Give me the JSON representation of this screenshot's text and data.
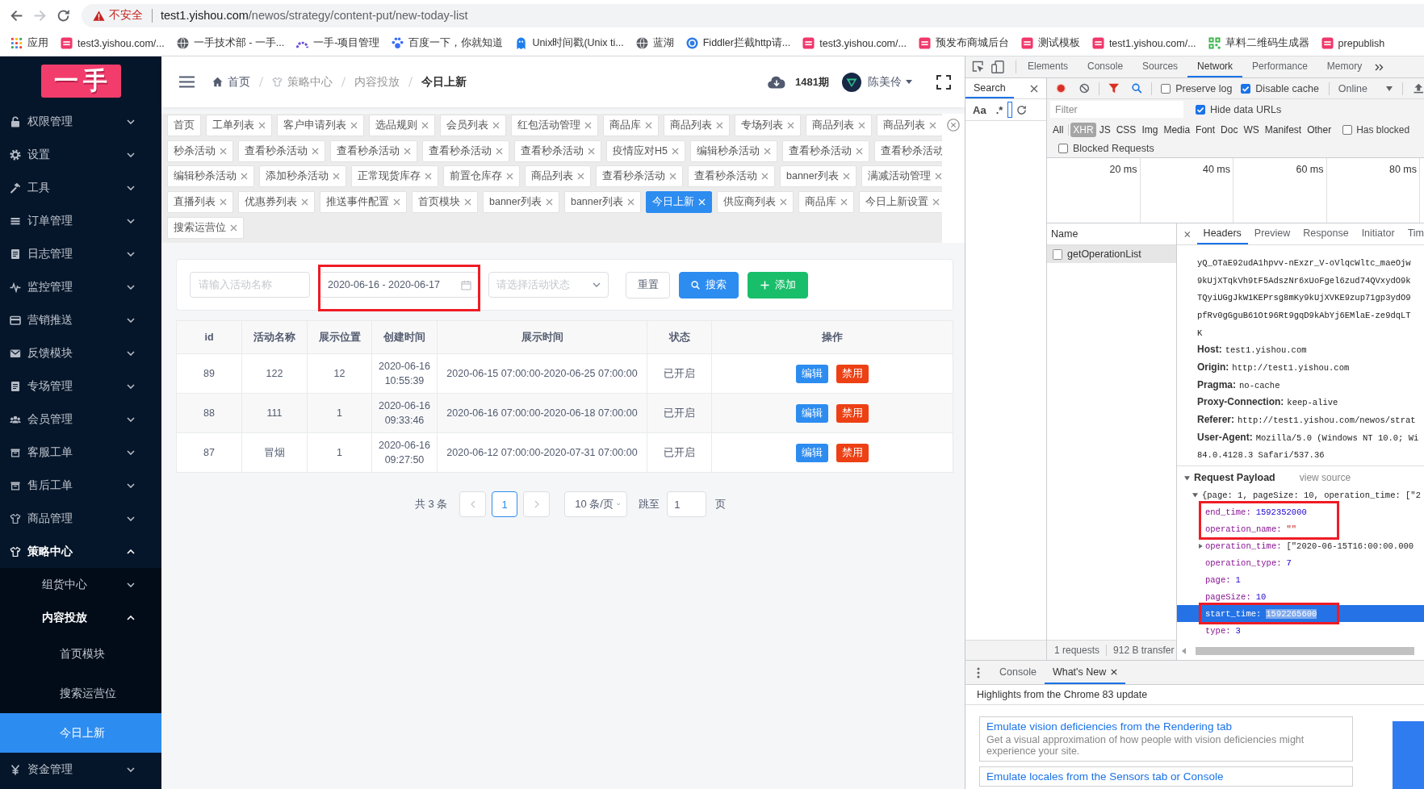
{
  "browser": {
    "back_disabled": false,
    "forward_disabled": true,
    "security": "不安全",
    "url_host": "test1.yishou.com",
    "url_path": "/newos/strategy/content-put/new-today-list",
    "bookmarks": [
      "应用",
      "test3.yishou.com/...",
      "一手技术部 - 一手...",
      "一手-项目管理",
      "百度一下，你就知道",
      "Unix时间戳(Unix ti...",
      "蓝湖",
      "Fiddler拦截http请...",
      "test3.yishou.com/...",
      "预发布商城后台",
      "测试模板",
      "test1.yishou.com/...",
      "草料二维码生成器",
      "prepublish"
    ]
  },
  "sidebar": {
    "logo": "一手",
    "items": [
      {
        "label": "权限管理",
        "expanded": false,
        "selected": false
      },
      {
        "label": "设置",
        "expanded": false,
        "selected": false
      },
      {
        "label": "工具",
        "expanded": false,
        "selected": false
      },
      {
        "label": "订单管理",
        "expanded": false,
        "selected": false
      },
      {
        "label": "日志管理",
        "expanded": false,
        "selected": false
      },
      {
        "label": "监控管理",
        "expanded": false,
        "selected": false
      },
      {
        "label": "营销推送",
        "expanded": false,
        "selected": false
      },
      {
        "label": "反馈模块",
        "expanded": false,
        "selected": false
      },
      {
        "label": "专场管理",
        "expanded": false,
        "selected": false
      },
      {
        "label": "会员管理",
        "expanded": false,
        "selected": false
      },
      {
        "label": "客服工单",
        "expanded": false,
        "selected": false
      },
      {
        "label": "售后工单",
        "expanded": false,
        "selected": false
      },
      {
        "label": "商品管理",
        "expanded": false,
        "selected": false
      },
      {
        "label": "策略中心",
        "expanded": true,
        "selected": false,
        "children": [
          {
            "label": "组货中心",
            "expanded": false,
            "selected": false
          },
          {
            "label": "内容投放",
            "expanded": true,
            "selected": false,
            "children": [
              {
                "label": "首页模块",
                "selected": false
              },
              {
                "label": "搜索运营位",
                "selected": false
              },
              {
                "label": "今日上新",
                "selected": true
              }
            ]
          }
        ]
      },
      {
        "label": "资金管理",
        "expanded": false,
        "selected": false
      }
    ]
  },
  "header": {
    "breadcrumb": [
      {
        "label": "首页",
        "link": true,
        "current": false
      },
      {
        "label": "策略中心",
        "link": false,
        "current": false
      },
      {
        "label": "内容投放",
        "link": false,
        "current": false
      },
      {
        "label": "今日上新",
        "link": false,
        "current": true
      }
    ],
    "period": "1481期",
    "user": "陈美伶"
  },
  "tags": {
    "rows": [
      {
        "tabs": [
          {
            "label": "首页",
            "closable": false,
            "selected": false
          },
          {
            "label": "工单列表",
            "closable": true,
            "selected": false
          },
          {
            "label": "客户申请列表",
            "closable": true,
            "selected": false
          },
          {
            "label": "选品规则",
            "closable": true,
            "selected": false
          },
          {
            "label": "会员列表",
            "closable": true,
            "selected": false
          },
          {
            "label": "红包活动管理",
            "closable": true,
            "selected": false
          },
          {
            "label": "商品库",
            "closable": true,
            "selected": false
          },
          {
            "label": "商品列表",
            "closable": true,
            "selected": false
          },
          {
            "label": "专场列表",
            "closable": true,
            "selected": false
          },
          {
            "label": "商品列表",
            "closable": true,
            "selected": false
          },
          {
            "label": "商品列表",
            "closable": true,
            "selected": false
          }
        ]
      },
      {
        "tabs": [
          {
            "label": "秒杀活动",
            "closable": true,
            "selected": false
          },
          {
            "label": "查看秒杀活动",
            "closable": true,
            "selected": false
          },
          {
            "label": "查看秒杀活动",
            "closable": true,
            "selected": false
          },
          {
            "label": "查看秒杀活动",
            "closable": true,
            "selected": false
          },
          {
            "label": "查看秒杀活动",
            "closable": true,
            "selected": false
          },
          {
            "label": "疫情应对H5",
            "closable": true,
            "selected": false
          },
          {
            "label": "编辑秒杀活动",
            "closable": true,
            "selected": false
          },
          {
            "label": "查看秒杀活动",
            "closable": true,
            "selected": false
          },
          {
            "label": "查看秒杀活动",
            "closable": true,
            "selected": false
          }
        ]
      },
      {
        "tabs": [
          {
            "label": "编辑秒杀活动",
            "closable": true,
            "selected": false
          },
          {
            "label": "添加秒杀活动",
            "closable": true,
            "selected": false
          },
          {
            "label": "正常现货库存",
            "closable": true,
            "selected": false
          },
          {
            "label": "前置仓库存",
            "closable": true,
            "selected": false
          },
          {
            "label": "商品列表",
            "closable": true,
            "selected": false
          },
          {
            "label": "查看秒杀活动",
            "closable": true,
            "selected": false
          },
          {
            "label": "查看秒杀活动",
            "closable": true,
            "selected": false
          },
          {
            "label": "banner列表",
            "closable": true,
            "selected": false
          },
          {
            "label": "满减活动管理",
            "closable": true,
            "selected": false
          }
        ]
      },
      {
        "tabs": [
          {
            "label": "直播列表",
            "closable": true,
            "selected": false
          },
          {
            "label": "优惠券列表",
            "closable": true,
            "selected": false
          },
          {
            "label": "推送事件配置",
            "closable": true,
            "selected": false
          },
          {
            "label": "首页模块",
            "closable": true,
            "selected": false
          },
          {
            "label": "banner列表",
            "closable": true,
            "selected": false
          },
          {
            "label": "banner列表",
            "closable": true,
            "selected": false
          },
          {
            "label": "今日上新",
            "closable": true,
            "selected": true
          },
          {
            "label": "供应商列表",
            "closable": true,
            "selected": false
          },
          {
            "label": "商品库",
            "closable": true,
            "selected": false
          },
          {
            "label": "今日上新设置",
            "closable": true,
            "selected": false
          }
        ]
      },
      {
        "tabs": [
          {
            "label": "搜索运营位",
            "closable": true,
            "selected": false
          }
        ]
      }
    ]
  },
  "filters": {
    "name_input": {
      "placeholder": "请输入活动名称"
    },
    "date_range": {
      "value": "2020-06-16 - 2020-06-17",
      "highlighted": true
    },
    "status_select": {
      "placeholder": "请选择活动状态"
    },
    "buttons": [
      {
        "label": "重置",
        "kind": "default"
      },
      {
        "label": "搜索",
        "kind": "primary"
      },
      {
        "label": "添加",
        "kind": "success"
      }
    ]
  },
  "table": {
    "columns": [
      "id",
      "活动名称",
      "展示位置",
      "创建时间",
      "展示时间",
      "状态",
      "操作"
    ],
    "rows": [
      {
        "cells": [
          "89",
          "122",
          "12",
          "2020-06-16 10:55:39",
          "2020-06-15 07:00:00-2020-06-25 07:00:00",
          "已开启"
        ],
        "actions": [
          {
            "label": "编辑",
            "kind": "edit"
          },
          {
            "label": "禁用",
            "kind": "disable"
          }
        ]
      },
      {
        "cells": [
          "88",
          "111",
          "1",
          "2020-06-16 09:33:46",
          "2020-06-16 07:00:00-2020-06-18 07:00:00",
          "已开启"
        ],
        "actions": [
          {
            "label": "编辑",
            "kind": "edit"
          },
          {
            "label": "禁用",
            "kind": "disable"
          }
        ]
      },
      {
        "cells": [
          "87",
          "冒烟",
          "1",
          "2020-06-16 09:27:50",
          "2020-06-12 07:00:00-2020-07-31 07:00:00",
          "已开启"
        ],
        "actions": [
          {
            "label": "编辑",
            "kind": "edit"
          },
          {
            "label": "禁用",
            "kind": "disable"
          }
        ]
      }
    ]
  },
  "pagination": {
    "total": "共 3 条",
    "prev_disabled": true,
    "next_disabled": true,
    "pages": [
      {
        "label": "1",
        "selected": true
      }
    ],
    "page_size": "10 条/页",
    "jump_label": "跳至",
    "jump_value": "1",
    "page_unit": "页"
  },
  "devtools": {
    "tabs": [
      {
        "label": "Elements",
        "selected": false
      },
      {
        "label": "Console",
        "selected": false
      },
      {
        "label": "Sources",
        "selected": false
      },
      {
        "label": "Network",
        "selected": true
      },
      {
        "label": "Performance",
        "selected": false
      },
      {
        "label": "Memory",
        "selected": false
      }
    ],
    "search_panel": {
      "tab": "Search",
      "options": [
        "Aa",
        ".*"
      ]
    },
    "toolbar": {
      "recording": true,
      "filter_active": true,
      "checkboxes": [
        {
          "label": "Preserve log",
          "checked": false
        },
        {
          "label": "Disable cache",
          "checked": true
        }
      ],
      "throttling": "Online"
    },
    "filter": {
      "placeholder": "Filter",
      "hide_data_urls": {
        "label": "Hide data URLs",
        "checked": true
      }
    },
    "types": [
      {
        "label": "All",
        "selected": false
      },
      {
        "label": "XHR",
        "selected": true
      },
      {
        "label": "JS",
        "selected": false
      },
      {
        "label": "CSS",
        "selected": false
      },
      {
        "label": "Img",
        "selected": false
      },
      {
        "label": "Media",
        "selected": false
      },
      {
        "label": "Font",
        "selected": false
      },
      {
        "label": "Doc",
        "selected": false
      },
      {
        "label": "WS",
        "selected": false
      },
      {
        "label": "Manifest",
        "selected": false
      },
      {
        "label": "Other",
        "selected": false
      }
    ],
    "has_blocked": {
      "label": "Has blocked",
      "checked": false
    },
    "blocked_requests": {
      "label": "Blocked Requests",
      "checked": false
    },
    "timeline_ticks": [
      "20 ms",
      "40 ms",
      "60 ms",
      "80 ms"
    ],
    "requests": {
      "column": "Name",
      "items": [
        {
          "name": "getOperationList",
          "selected": true
        }
      ],
      "summary": [
        "1 requests",
        "912 B transfer"
      ]
    },
    "detail_tabs": [
      {
        "label": "Headers",
        "selected": true
      },
      {
        "label": "Preview",
        "selected": false
      },
      {
        "label": "Response",
        "selected": false
      },
      {
        "label": "Initiator",
        "selected": false
      },
      {
        "label": "Tim",
        "selected": false
      }
    ],
    "header_lines": [
      {
        "value": "yQ_OTaE92udA1hpvv-nExzr_V-oVlqcWltc_maeOjw"
      },
      {
        "value": "9kUjXTqkVh9tF5AdszNr6xUoFgel6zud74QVxydO9k"
      },
      {
        "value": "TQyiUGgJkW1KEPrsg8mKy9kUjXVKE9zup71gp3ydO9"
      },
      {
        "value": "pfRv0gGguB61Ot96Rt9gqD9kAbYj6EMlaE-ze9dqLT"
      },
      {
        "value": "K"
      },
      {
        "key": "Host:",
        "value": "test1.yishou.com"
      },
      {
        "key": "Origin:",
        "value": "http://test1.yishou.com"
      },
      {
        "key": "Pragma:",
        "value": "no-cache"
      },
      {
        "key": "Proxy-Connection:",
        "value": "keep-alive"
      },
      {
        "key": "Referer:",
        "value": "http://test1.yishou.com/newos/strat"
      },
      {
        "key": "User-Agent:",
        "value": "Mozilla/5.0 (Windows NT 10.0; Wi"
      },
      {
        "value": "84.0.4128.3 Safari/537.36"
      }
    ],
    "payload": {
      "title": "Request Payload",
      "expanded": true,
      "view_source": "view source",
      "summary": "{page: 1, pageSize: 10, operation_time: [\"2",
      "summary_expanded": true,
      "fields": [
        {
          "key": "end_time:",
          "value": "1592352000",
          "kind": "number",
          "framed": true,
          "selected": false
        },
        {
          "key": "operation_name:",
          "value": "\"\"",
          "kind": "string",
          "framed": true,
          "selected": false
        },
        {
          "key": "operation_time:",
          "value": "[\"2020-06-15T16:00:00.000",
          "kind": "array",
          "expanded": false,
          "framed": false,
          "selected": false
        },
        {
          "key": "operation_type:",
          "value": "7",
          "kind": "number",
          "framed": false,
          "selected": false
        },
        {
          "key": "page:",
          "value": "1",
          "kind": "number",
          "framed": false,
          "selected": false
        },
        {
          "key": "pageSize:",
          "value": "10",
          "kind": "number",
          "framed": false,
          "selected": false
        },
        {
          "key": "start_time:",
          "value": "1592265600",
          "kind": "number",
          "framed": true,
          "selected": true
        },
        {
          "key": "type:",
          "value": "3",
          "kind": "number",
          "framed": false,
          "selected": false
        }
      ]
    },
    "drawer": {
      "tabs": [
        {
          "label": "Console",
          "selected": false,
          "closable": false
        },
        {
          "label": "What's New",
          "selected": true,
          "closable": true
        }
      ],
      "headline": "Highlights from the Chrome 83 update",
      "cards": [
        {
          "title": "Emulate vision deficiencies from the Rendering tab",
          "text": "Get a visual approximation of how people with vision deficiencies might experience your site."
        },
        {
          "title": "Emulate locales from the Sensors tab or Console"
        }
      ]
    }
  }
}
